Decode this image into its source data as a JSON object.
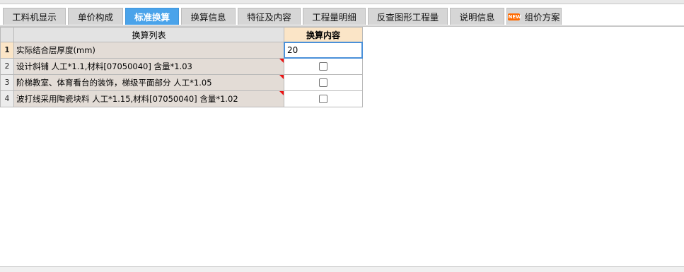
{
  "tabs": [
    {
      "label": "工料机显示"
    },
    {
      "label": "单价构成"
    },
    {
      "label": "标准换算",
      "active": true
    },
    {
      "label": "换算信息"
    },
    {
      "label": "特征及内容"
    },
    {
      "label": "工程量明细"
    },
    {
      "label": "反查图形工程量"
    },
    {
      "label": "说明信息"
    },
    {
      "label": "组价方案",
      "badge": "NEW"
    }
  ],
  "table": {
    "headers": {
      "list": "换算列表",
      "content": "换算内容"
    },
    "rows": [
      {
        "num": "1",
        "name": "实际结合层厚度(mm)",
        "value": "20",
        "type": "input"
      },
      {
        "num": "2",
        "name": "设计斜铺 人工*1.1,材料[07050040] 含量*1.03",
        "type": "checkbox",
        "checked": false
      },
      {
        "num": "3",
        "name": "阶梯教室、体育看台的装饰，梯级平面部分 人工*1.05",
        "type": "checkbox",
        "checked": false
      },
      {
        "num": "4",
        "name": "波打线采用陶瓷块料 人工*1.15,材料[07050040] 含量*1.02",
        "type": "checkbox",
        "checked": false
      }
    ]
  }
}
